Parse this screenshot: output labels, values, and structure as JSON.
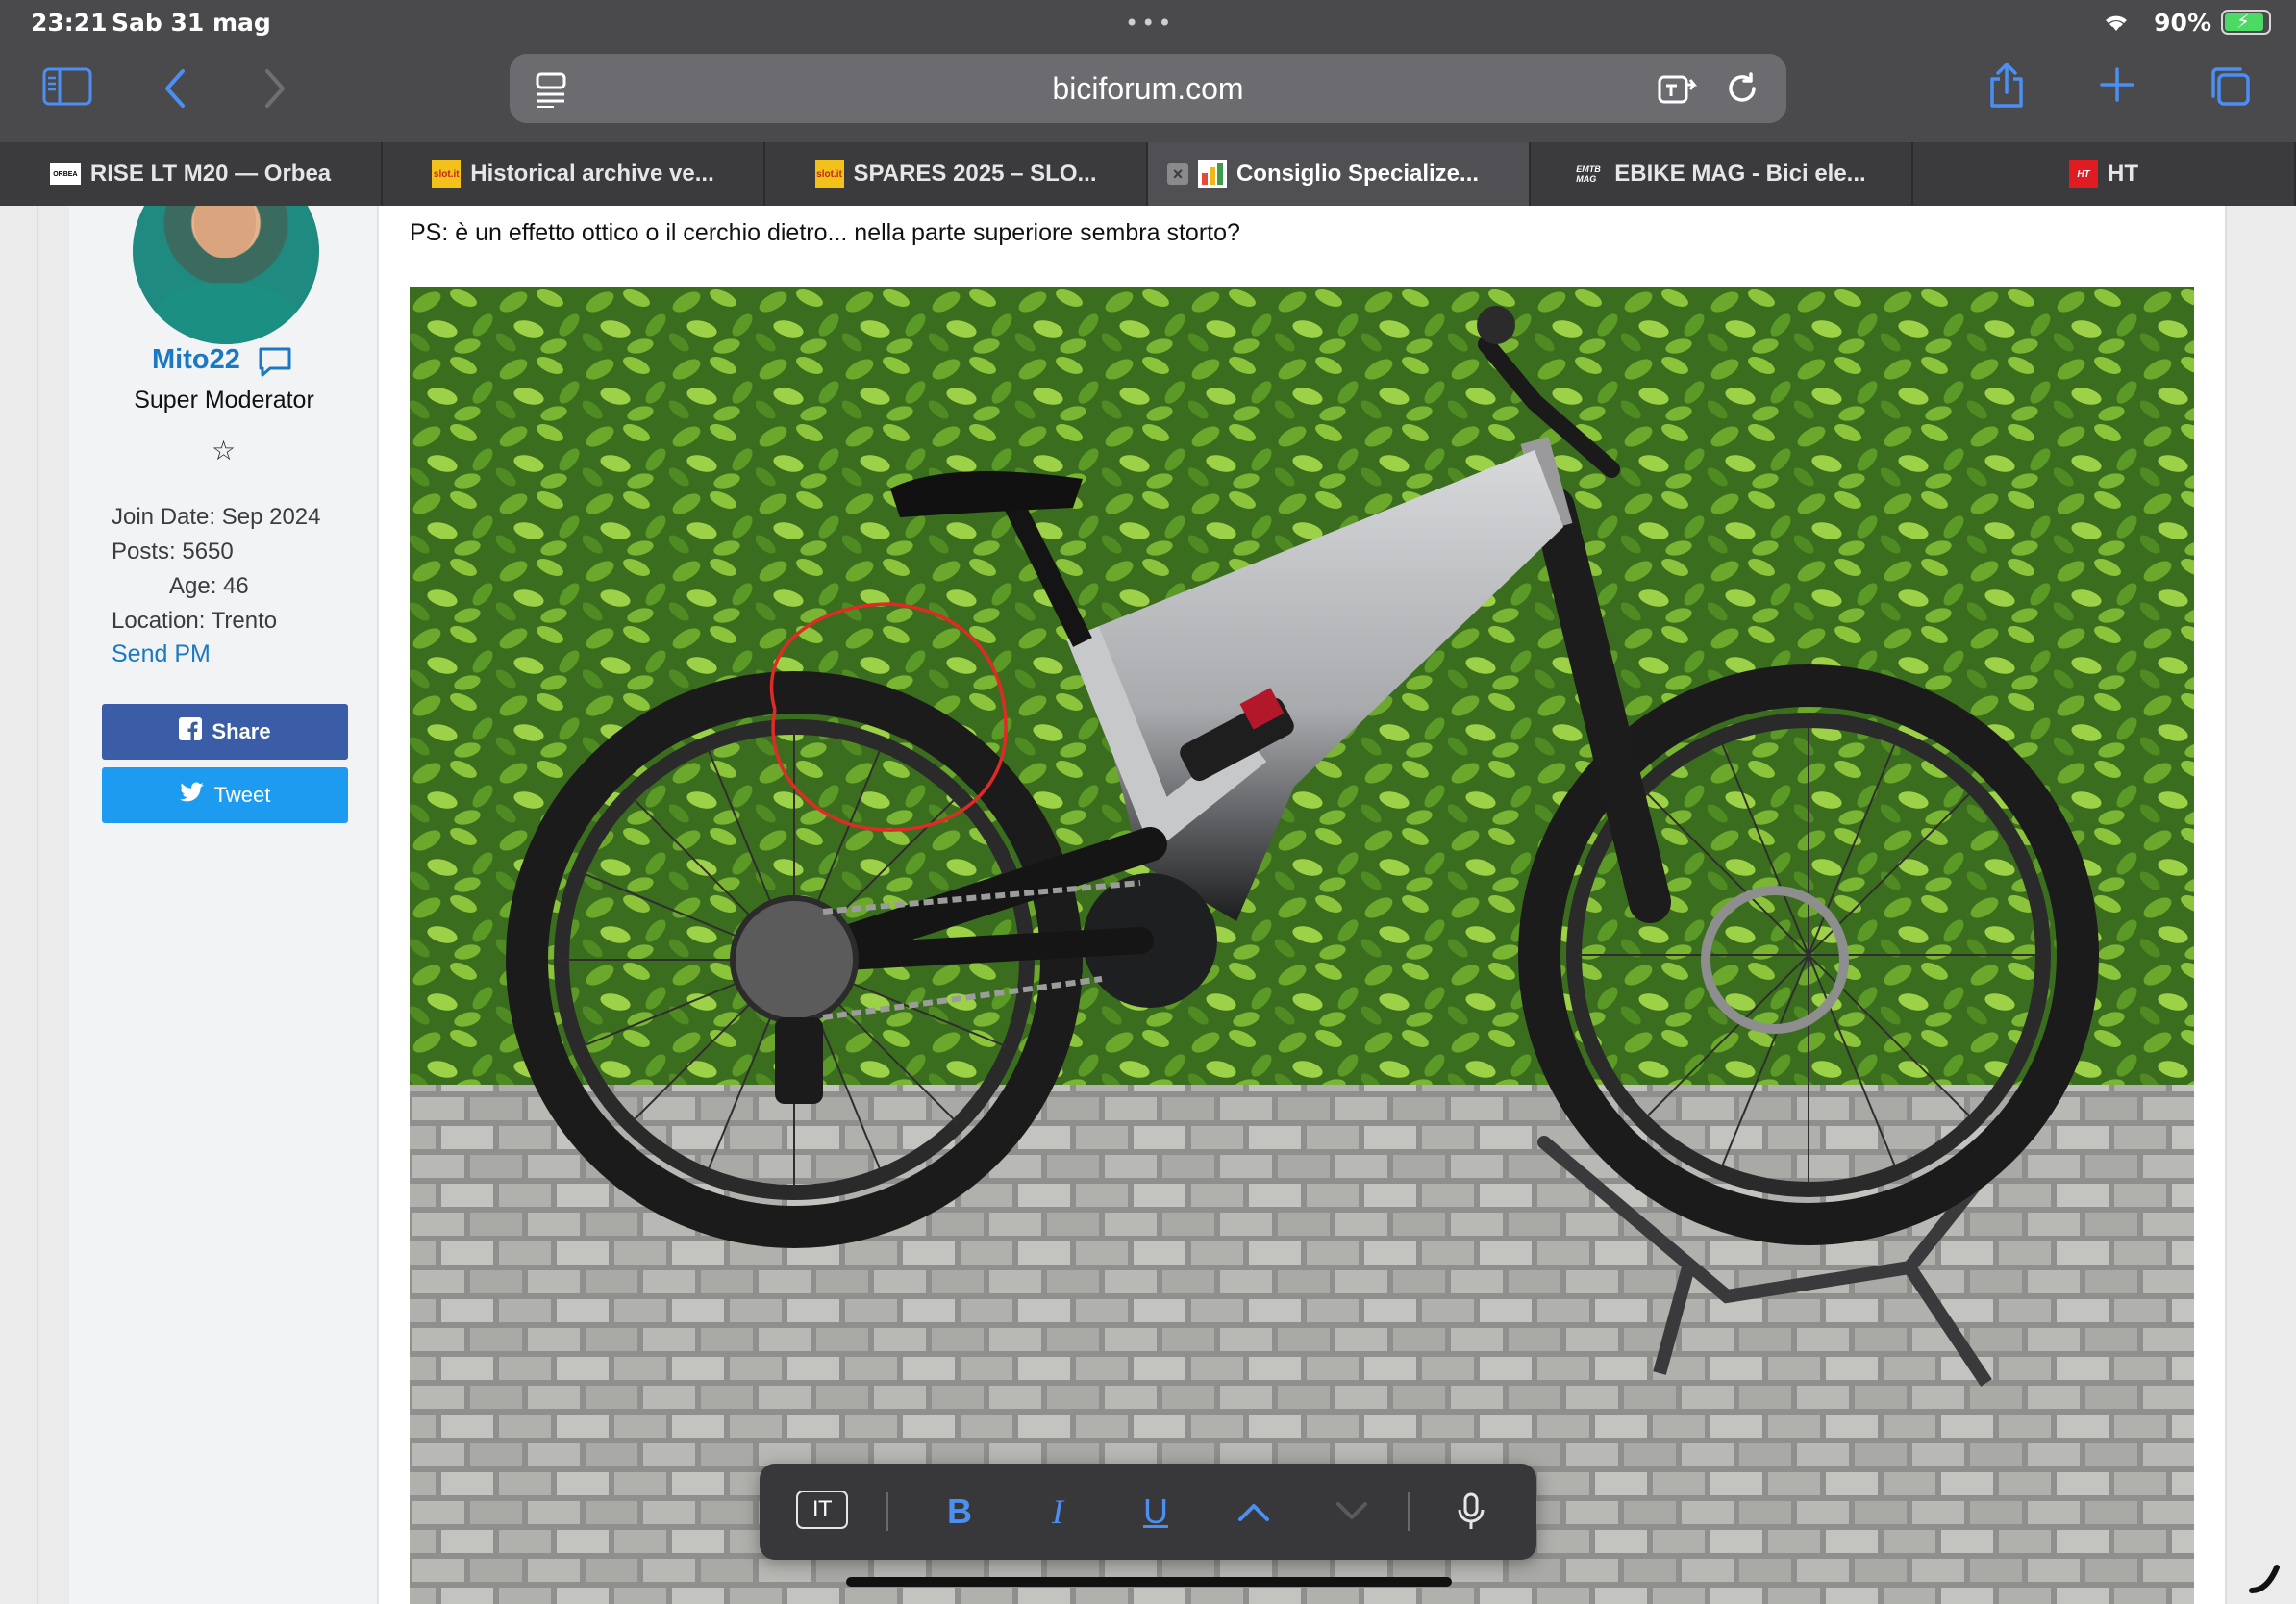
{
  "status": {
    "time": "23:21",
    "date": "Sab 31 mag",
    "battery_percent": "90%",
    "battery_level": 0.9
  },
  "toolbar": {
    "url": "biciforum.com",
    "icons": [
      "sidebar-icon",
      "back-icon",
      "forward-icon",
      "reader-icon",
      "translate-icon",
      "reload-icon",
      "share-icon",
      "plus-icon",
      "tabs-icon"
    ]
  },
  "tabs": [
    {
      "label": "RISE LT M20 — Orbea",
      "favicon": "orbea"
    },
    {
      "label": "Historical archive ve...",
      "favicon": "slot.it"
    },
    {
      "label": "SPARES 2025 – SLO...",
      "favicon": "slot.it"
    },
    {
      "label": "Consiglio Specialize...",
      "favicon": "biciforum",
      "active": true
    },
    {
      "label": "EBIKE MAG - Bici ele...",
      "favicon": "emtb-mag"
    },
    {
      "label": "HT",
      "favicon": "ht"
    }
  ],
  "profile": {
    "username": "Mito22",
    "role": "Super Moderator",
    "join_date": "Join Date: Sep 2024",
    "posts": "Posts: 5650",
    "age": "Age: 46",
    "location": "Location: Trento",
    "send_pm": "Send PM",
    "share_label": "Share",
    "tweet_label": "Tweet"
  },
  "post": {
    "text": "PS: è un effetto ottico o il cerchio dietro... nella parte superiore sembra storto?"
  },
  "keyboard_bar": {
    "lang": "IT",
    "bold": "B",
    "italic": "I",
    "underline": "U"
  },
  "colors": {
    "accent": "#4b8ff2",
    "link": "#1a79c2",
    "share": "#3b5da7",
    "tweet": "#1d9bf0"
  }
}
